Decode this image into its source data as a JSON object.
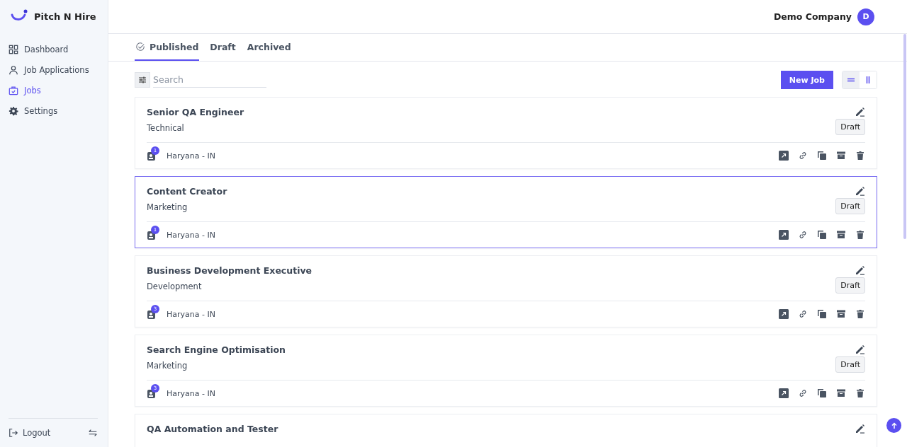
{
  "brand": {
    "name": "Pitch N Hire"
  },
  "sidebar": {
    "items": [
      {
        "label": "Dashboard",
        "kind": "grid",
        "selected": false
      },
      {
        "label": "Job Applications",
        "kind": "person",
        "selected": false
      },
      {
        "label": "Jobs",
        "kind": "bag",
        "selected": true
      },
      {
        "label": "Settings",
        "kind": "gear",
        "selected": false
      }
    ],
    "logout": "Logout"
  },
  "header": {
    "company": "Demo Company",
    "avatar": "D"
  },
  "tabs": [
    {
      "label": "Published",
      "selected": true
    },
    {
      "label": "Draft",
      "selected": false
    },
    {
      "label": "Archived",
      "selected": false
    }
  ],
  "search": {
    "placeholder": "Search"
  },
  "new_job_button": "New Job",
  "view_toggle": [
    {
      "kind": "list",
      "selected": true
    },
    {
      "kind": "columns",
      "selected": false
    }
  ],
  "jobs": [
    {
      "title": "Senior QA Engineer",
      "category": "Technical",
      "status": "Draft",
      "applicants": "1",
      "location": "Haryana - IN",
      "selected": false
    },
    {
      "title": "Content Creator",
      "category": "Marketing",
      "status": "Draft",
      "applicants": "1",
      "location": "Haryana - IN",
      "selected": true
    },
    {
      "title": "Business Development Executive",
      "category": "Development",
      "status": "Draft",
      "applicants": "3",
      "location": "Haryana - IN",
      "selected": false
    },
    {
      "title": "Search Engine Optimisation",
      "category": "Marketing",
      "status": "Draft",
      "applicants": "3",
      "location": "Haryana - IN",
      "selected": false
    },
    {
      "title": "QA Automation and Tester",
      "selected": false
    }
  ]
}
